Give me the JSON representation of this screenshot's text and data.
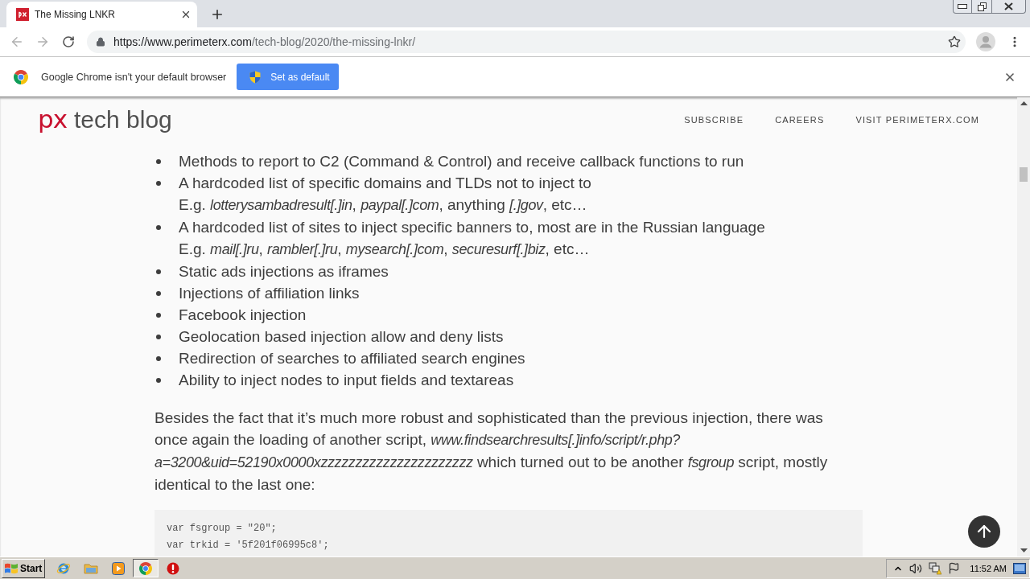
{
  "browser": {
    "tabs": [
      {
        "title": "The Missing LNKR",
        "selected": true
      }
    ],
    "address": {
      "host": "https://www.perimeterx.com",
      "path": "/tech-blog/2020/the-missing-lnkr/"
    }
  },
  "infobar": {
    "message": "Google Chrome isn't your default browser",
    "button": "Set as default"
  },
  "site_header": {
    "logo_mark": "px",
    "logo_text": "tech blog",
    "nav": [
      "SUBSCRIBE",
      "CAREERS",
      "VISIT PERIMETERX.COM"
    ]
  },
  "article": {
    "bullets": [
      {
        "text": "Methods to report to C2 (Command & Control) and receive callback functions to run"
      },
      {
        "text": "A hardcoded list of specific domains and TLDs not to inject to",
        "example": "E.g. *lotterysambadresult[.]in*, *paypal[.]com*, anything *[.]gov*, etc…"
      },
      {
        "text": "A hardcoded list of sites to inject specific banners to, most are in the Russian language",
        "example": "E.g. *mail[.]ru*, *rambler[.]ru*, *mysearch[.]com*, *securesurf[.]biz*, etc…"
      },
      {
        "text": "Static ads injections as iframes"
      },
      {
        "text": "Injections of affiliation links"
      },
      {
        "text": "Facebook injection"
      },
      {
        "text": "Geolocation based injection allow and deny lists"
      },
      {
        "text": "Redirection of searches to affiliated search engines"
      },
      {
        "text": "Ability to inject nodes to input fields and textareas"
      }
    ],
    "paragraph": "Besides the fact that it’s much more robust and sophisticated than the previous injection, there was once again the loading of another script, *www.findsearchresults[.]info/script/r.php?a=3200&uid=52190x0000xzzzzzzzzzzzzzzzzzzzzzz* which turned out to be another *fsgroup* script, mostly identical to the last one:",
    "code": [
      "var fsgroup = \"20\";",
      "var trkid = '5f201f06995c8';"
    ]
  },
  "taskbar": {
    "start": "Start",
    "apps": [
      {
        "kind": "ie",
        "selected": false
      },
      {
        "kind": "folder",
        "selected": false
      },
      {
        "kind": "media",
        "selected": false
      },
      {
        "kind": "chrome",
        "selected": true
      },
      {
        "kind": "alert",
        "selected": false
      }
    ],
    "clock": "11:52 AM"
  }
}
